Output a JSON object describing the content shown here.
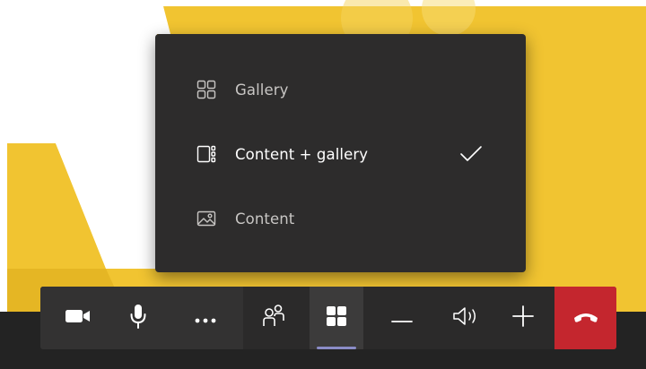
{
  "colors": {
    "background_yellow": "#f1c431",
    "menu_background": "#2d2c2c",
    "menu_text_default": "#c8c6c4",
    "menu_text_selected": "#ffffff",
    "active_indicator": "#8b8cc7",
    "hangup_red": "#c4262e"
  },
  "layout_menu": {
    "items": [
      {
        "label": "Gallery",
        "icon": "gallery-grid-icon",
        "selected": false
      },
      {
        "label": "Content + gallery",
        "icon": "content-plus-gallery-icon",
        "selected": true
      },
      {
        "label": "Content",
        "icon": "content-image-icon",
        "selected": false
      }
    ],
    "check_icon": "checkmark-icon"
  },
  "call_bar": {
    "buttons": [
      {
        "icon": "camera-icon"
      },
      {
        "icon": "microphone-icon"
      },
      {
        "icon": "more-options-icon"
      },
      {
        "icon": "participants-icon"
      },
      {
        "icon": "layout-grid-icon",
        "active": true
      },
      {
        "icon": "volume-down-icon"
      },
      {
        "icon": "speaker-icon"
      },
      {
        "icon": "volume-up-icon"
      },
      {
        "icon": "hang-up-icon"
      }
    ]
  }
}
